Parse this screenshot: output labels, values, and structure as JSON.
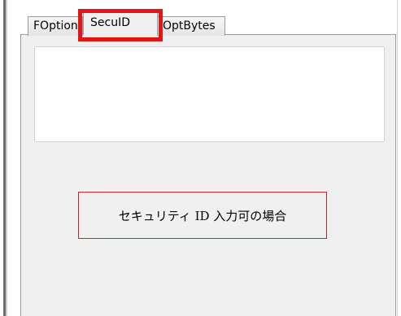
{
  "tabs": {
    "foption": "FOption",
    "seculd": "SecuID",
    "optbytes": "OptBytes"
  },
  "input": {
    "value": ""
  },
  "annotation": {
    "text": "セキュリティ ID 入力可の場合"
  },
  "colors": {
    "highlight": "#e21616",
    "panel": "#f0f0f0"
  }
}
